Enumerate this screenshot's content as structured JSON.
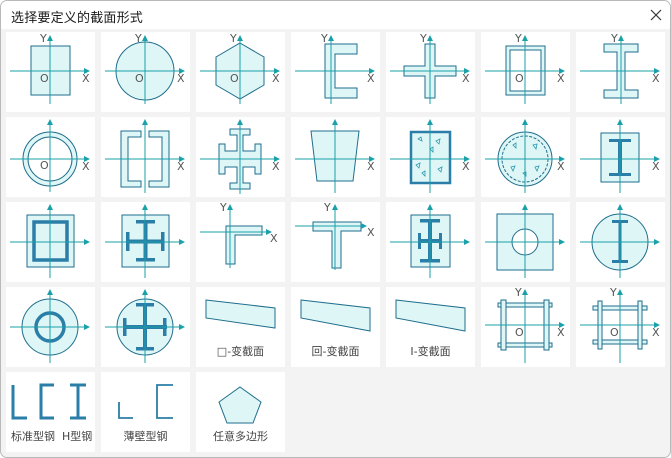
{
  "window": {
    "title": "选择要定义的截面形式",
    "close_icon": "close-icon"
  },
  "axes": {
    "x": "X",
    "y": "Y",
    "origin": "O"
  },
  "colors": {
    "stroke": "#1f6e8c",
    "fill": "#dff6f7",
    "axis": "#1aa0a8",
    "steel": "#2a7ea8",
    "tile_bg": "#ffffff",
    "dialog_bg": "#f3f3f3"
  },
  "tiles": [
    {
      "name": "rectangle-section"
    },
    {
      "name": "circle-section"
    },
    {
      "name": "hexagon-section"
    },
    {
      "name": "channel-section"
    },
    {
      "name": "cross-section"
    },
    {
      "name": "box-section"
    },
    {
      "name": "i-beam-section"
    },
    {
      "name": "pipe-section"
    },
    {
      "name": "double-channel-section"
    },
    {
      "name": "cruciform-i-section"
    },
    {
      "name": "trapezoid-section"
    },
    {
      "name": "concrete-rect-section"
    },
    {
      "name": "concrete-circle-section"
    },
    {
      "name": "rect-encased-i-section"
    },
    {
      "name": "rect-box-encased-section"
    },
    {
      "name": "rect-encased-cross-i-section"
    },
    {
      "name": "angle-section"
    },
    {
      "name": "tee-section"
    },
    {
      "name": "rect-encased-double-i-section"
    },
    {
      "name": "rect-with-hole-section"
    },
    {
      "name": "circle-encased-i-section"
    },
    {
      "name": "circle-encased-pipe-section"
    },
    {
      "name": "circle-encased-cross-i-section"
    },
    {
      "name": "rect-tapered-section",
      "label_icon": "□",
      "label_text": "-变截面"
    },
    {
      "name": "box-tapered-section",
      "label_icon": "回",
      "label_text": "-变截面"
    },
    {
      "name": "i-tapered-section",
      "label_icon": "I",
      "label_text": "-变截面"
    },
    {
      "name": "lattice-section-a"
    },
    {
      "name": "lattice-section-b"
    },
    {
      "name": "standard-steel",
      "label_a": "标准型钢",
      "label_b": "H型钢"
    },
    {
      "name": "thin-walled-steel",
      "label": "薄壁型钢"
    },
    {
      "name": "polygon-section",
      "label": "任意多边形"
    }
  ]
}
